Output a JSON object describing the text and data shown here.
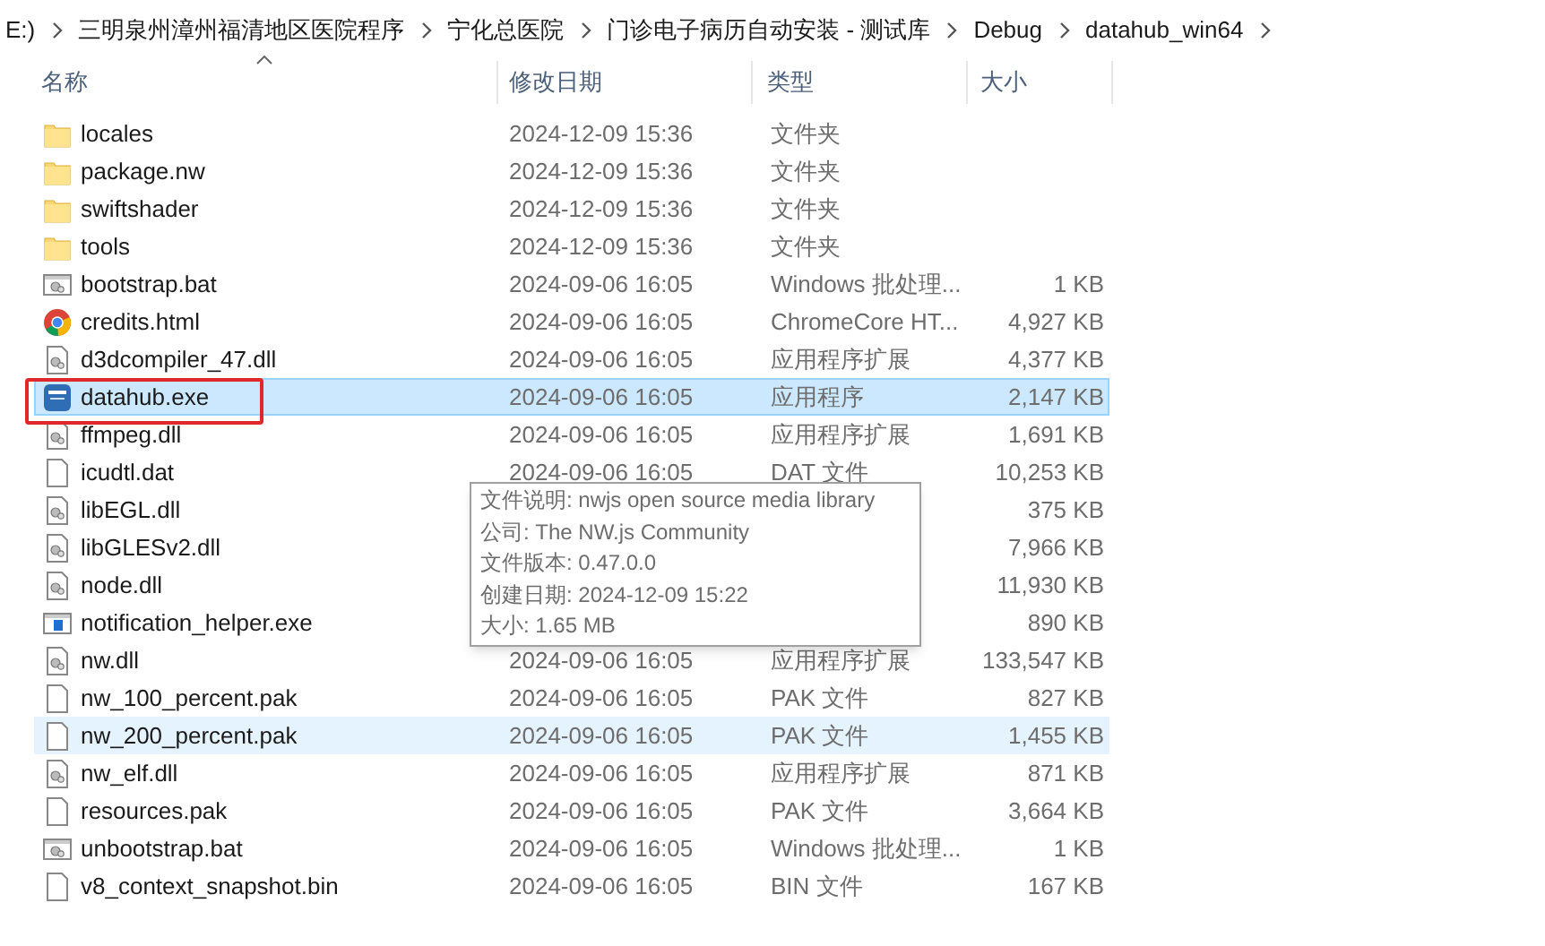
{
  "breadcrumb": [
    "E:)",
    "三明泉州漳州福清地区医院程序",
    "宁化总医院",
    "门诊电子病历自动安装 - 测试库",
    "Debug",
    "datahub_win64"
  ],
  "table": {
    "columns": [
      "名称",
      "修改日期",
      "类型",
      "大小"
    ],
    "rows": [
      {
        "kind": "folder",
        "name": "locales",
        "date": "2024-12-09 15:36",
        "type": "文件夹",
        "selected": false,
        "hover": false
      },
      {
        "kind": "folder",
        "name": "package.nw",
        "date": "2024-12-09 15:36",
        "type": "文件夹",
        "selected": false,
        "hover": false
      },
      {
        "kind": "folder",
        "name": "swiftshader",
        "date": "2024-12-09 15:36",
        "type": "文件夹",
        "selected": false,
        "hover": false
      },
      {
        "kind": "folder",
        "name": "tools",
        "date": "2024-12-09 15:36",
        "type": "文件夹",
        "selected": false,
        "hover": false
      },
      {
        "kind": "batch",
        "name": "bootstrap.bat",
        "date": "2024-09-06 16:05",
        "type": "Windows 批处理...",
        "size": "1 KB",
        "selected": false,
        "hover": false
      },
      {
        "kind": "browser",
        "name": "credits.html",
        "date": "2024-09-06 16:05",
        "type": "ChromeCore HT...",
        "size": "4,927 KB",
        "selected": false,
        "hover": false
      },
      {
        "kind": "library",
        "name": "d3dcompiler_47.dll",
        "date": "2024-09-06 16:05",
        "type": "应用程序扩展",
        "size": "4,377 KB",
        "selected": false,
        "hover": false
      },
      {
        "kind": "app",
        "name": "datahub.exe",
        "date": "2024-09-06 16:05",
        "type": "应用程序",
        "size": "2,147 KB",
        "selected": true,
        "hover": false
      },
      {
        "kind": "library",
        "name": "ffmpeg.dll",
        "date": "2024-09-06 16:05",
        "type": "应用程序扩展",
        "size": "1,691 KB",
        "selected": false,
        "hover": false
      },
      {
        "kind": "file",
        "name": "icudtl.dat",
        "date": "2024-09-06 16:05",
        "type": "DAT 文件",
        "size": "10,253 KB",
        "selected": false,
        "hover": false
      },
      {
        "kind": "library",
        "name": "libEGL.dll",
        "size": "375 KB",
        "selected": false,
        "hover": false
      },
      {
        "kind": "library",
        "name": "libGLESv2.dll",
        "size": "7,966 KB",
        "selected": false,
        "hover": false
      },
      {
        "kind": "library",
        "name": "node.dll",
        "size": "11,930 KB",
        "selected": false,
        "hover": false
      },
      {
        "kind": "window",
        "name": "notification_helper.exe",
        "size": "890 KB",
        "selected": false,
        "hover": false
      },
      {
        "kind": "library",
        "name": "nw.dll",
        "date": "2024-09-06 16:05",
        "type": "应用程序扩展",
        "size": "133,547 KB",
        "selected": false,
        "hover": false
      },
      {
        "kind": "file",
        "name": "nw_100_percent.pak",
        "date": "2024-09-06 16:05",
        "type": "PAK 文件",
        "size": "827 KB",
        "selected": false,
        "hover": false
      },
      {
        "kind": "file",
        "name": "nw_200_percent.pak",
        "date": "2024-09-06 16:05",
        "type": "PAK 文件",
        "size": "1,455 KB",
        "selected": false,
        "hover": true
      },
      {
        "kind": "library",
        "name": "nw_elf.dll",
        "date": "2024-09-06 16:05",
        "type": "应用程序扩展",
        "size": "871 KB",
        "selected": false,
        "hover": false
      },
      {
        "kind": "file",
        "name": "resources.pak",
        "date": "2024-09-06 16:05",
        "type": "PAK 文件",
        "size": "3,664 KB",
        "selected": false,
        "hover": false
      },
      {
        "kind": "batch",
        "name": "unbootstrap.bat",
        "date": "2024-09-06 16:05",
        "type": "Windows 批处理...",
        "size": "1 KB",
        "selected": false,
        "hover": false
      },
      {
        "kind": "file",
        "name": "v8_context_snapshot.bin",
        "date": "2024-09-06 16:05",
        "type": "BIN 文件",
        "size": "167 KB",
        "selected": false,
        "hover": false
      }
    ]
  },
  "tooltip": {
    "lines": [
      "文件说明: nwjs open source media library",
      "公司: The NW.js Community",
      "文件版本: 0.47.0.0",
      "创建日期: 2024-12-09 15:22",
      "大小: 1.65 MB"
    ]
  }
}
